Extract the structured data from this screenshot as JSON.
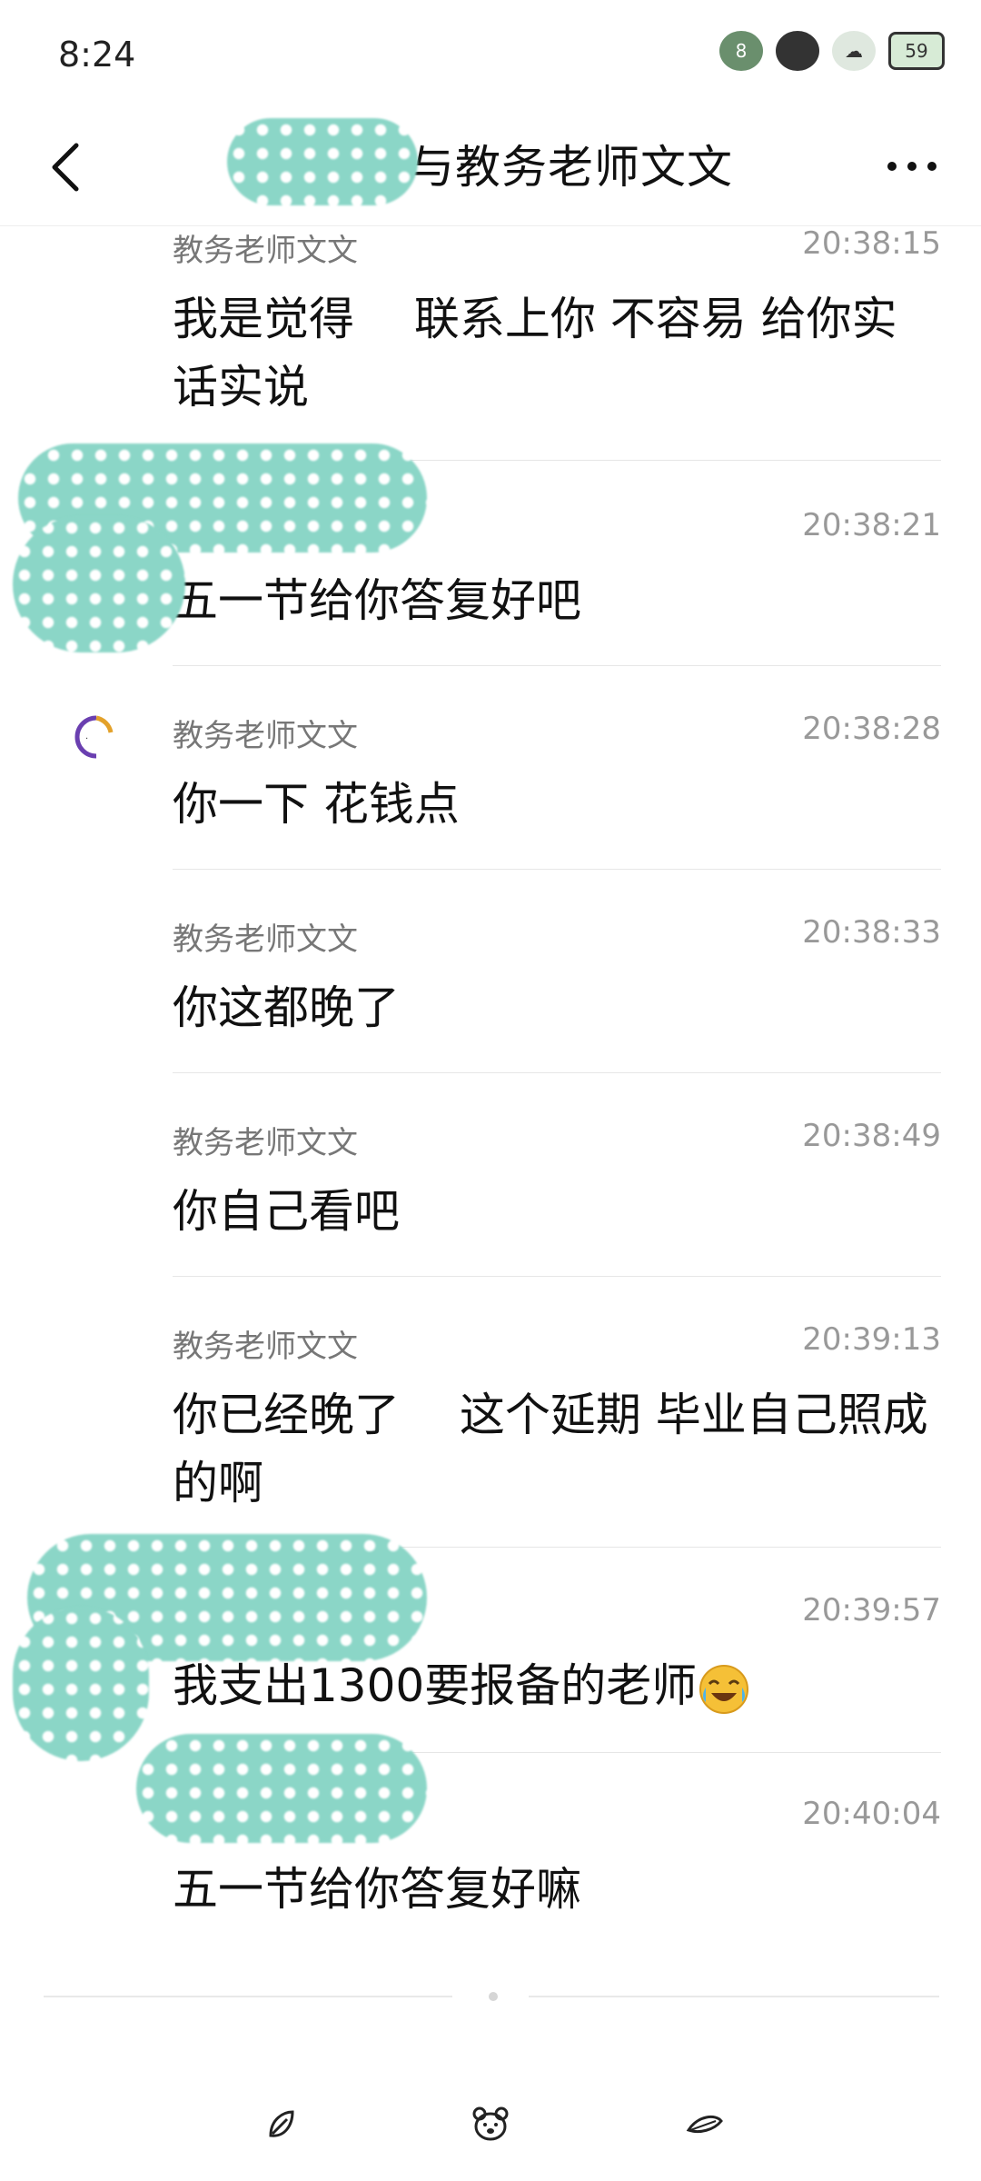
{
  "status_bar": {
    "time": "8:24",
    "icons": [
      "notification-badge-8",
      "hd-signal",
      "wifi-sheep",
      "battery"
    ],
    "notif_count": "8",
    "battery_level": "59"
  },
  "nav": {
    "title": "与教务老师文文"
  },
  "messages": [
    {
      "sender": "教务老师文文",
      "time": "20:38:15",
      "text": "我是觉得　 联系上你 不容易 给你实话实说"
    },
    {
      "sender": "",
      "time": "20:38:21",
      "text": "五一节给你答复好吧"
    },
    {
      "sender": "教务老师文文",
      "time": "20:38:28",
      "text": "你一下 花钱点"
    },
    {
      "sender": "教务老师文文",
      "time": "20:38:33",
      "text": "你这都晚了"
    },
    {
      "sender": "教务老师文文",
      "time": "20:38:49",
      "text": "你自己看吧"
    },
    {
      "sender": "教务老师文文",
      "time": "20:39:13",
      "text": "你已经晚了　 这个延期 毕业自己照成的啊"
    },
    {
      "sender": "",
      "time": "20:39:57",
      "text": "我支出1300要报备的老师"
    },
    {
      "sender": "",
      "time": "20:40:04",
      "text": "五一节给你答复好嘛"
    }
  ],
  "toolbar": {
    "icons": [
      "leaf-icon",
      "bear-icon",
      "feather-icon"
    ]
  },
  "colors": {
    "redaction": "#8bd6c7",
    "sender": "#777777",
    "time": "#999999",
    "divider": "#e6e6e6"
  }
}
